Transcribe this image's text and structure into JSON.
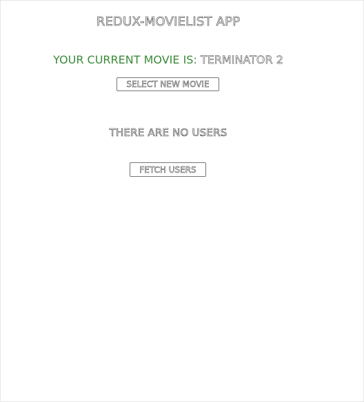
{
  "app": {
    "title": "REDUX-MOVIELIST APP"
  },
  "movie": {
    "label": "YOUR CURRENT MOVIE IS: ",
    "current": "TERMINATOR 2",
    "label_color": "#3a8a3a",
    "select_button_label": "SELECT NEW MOVIE"
  },
  "users": {
    "empty_message": "THERE ARE NO USERS",
    "fetch_button_label": "FETCH USERS"
  }
}
